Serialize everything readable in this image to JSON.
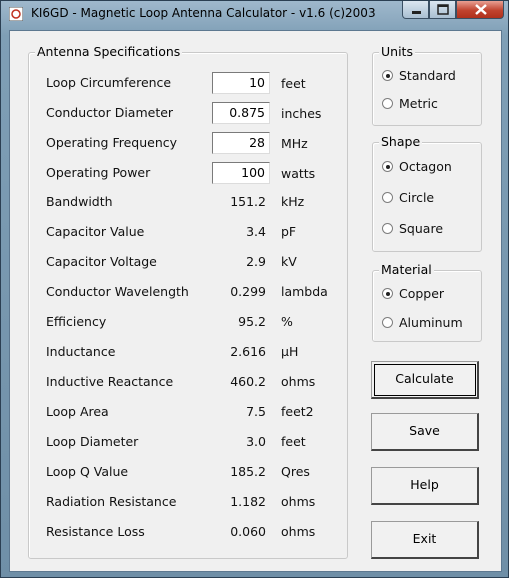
{
  "window": {
    "title": "KI6GD - Magnetic Loop Antenna Calculator - v1.6  (c)2003"
  },
  "specs": {
    "title": "Antenna Specifications",
    "inputs": [
      {
        "label": "Loop Circumference",
        "value": "10",
        "unit": "feet"
      },
      {
        "label": "Conductor Diameter",
        "value": "0.875",
        "unit": "inches"
      },
      {
        "label": "Operating Frequency",
        "value": "28",
        "unit": "MHz"
      },
      {
        "label": "Operating Power",
        "value": "100",
        "unit": "watts"
      }
    ],
    "outputs": [
      {
        "label": "Bandwidth",
        "value": "151.2",
        "unit": "kHz"
      },
      {
        "label": "Capacitor Value",
        "value": "3.4",
        "unit": "pF"
      },
      {
        "label": "Capacitor Voltage",
        "value": "2.9",
        "unit": "kV"
      },
      {
        "label": "Conductor Wavelength",
        "value": "0.299",
        "unit": "lambda"
      },
      {
        "label": "Efficiency",
        "value": "95.2",
        "unit": "%"
      },
      {
        "label": "Inductance",
        "value": "2.616",
        "unit": "µH"
      },
      {
        "label": "Inductive Reactance",
        "value": "460.2",
        "unit": "ohms"
      },
      {
        "label": "Loop Area",
        "value": "7.5",
        "unit": "feet2"
      },
      {
        "label": "Loop Diameter",
        "value": "3.0",
        "unit": "feet"
      },
      {
        "label": "Loop Q Value",
        "value": "185.2",
        "unit": "Qres"
      },
      {
        "label": "Radiation Resistance",
        "value": "1.182",
        "unit": "ohms"
      },
      {
        "label": "Resistance Loss",
        "value": "0.060",
        "unit": "ohms"
      }
    ]
  },
  "units": {
    "title": "Units",
    "options": [
      {
        "label": "Standard",
        "selected": true
      },
      {
        "label": "Metric",
        "selected": false
      }
    ]
  },
  "shape": {
    "title": "Shape",
    "options": [
      {
        "label": "Octagon",
        "selected": true
      },
      {
        "label": "Circle",
        "selected": false
      },
      {
        "label": "Square",
        "selected": false
      }
    ]
  },
  "material": {
    "title": "Material",
    "options": [
      {
        "label": "Copper",
        "selected": true
      },
      {
        "label": "Aluminum",
        "selected": false
      }
    ]
  },
  "buttons": {
    "calculate": "Calculate",
    "save": "Save",
    "help": "Help",
    "exit": "Exit"
  },
  "icons": {
    "app": "antenna-icon",
    "minimize": "minimize-icon",
    "maximize": "maximize-icon",
    "close": "close-icon"
  }
}
